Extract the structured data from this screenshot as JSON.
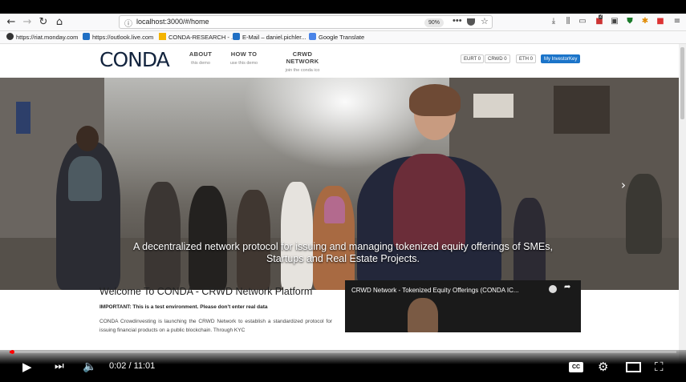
{
  "browser": {
    "url": "localhost:3000/#/home",
    "zoom": "90%",
    "bookmarks": [
      "https://riat.monday.com",
      "https://outlook.live.com",
      "CONDA-RESEARCH - ...",
      "E-Mail – daniel.pichler...",
      "Google Translate"
    ],
    "notif_badge": "2"
  },
  "site": {
    "logo": "CONDA",
    "menu": [
      {
        "title": "ABOUT",
        "sub": "this demo"
      },
      {
        "title": "HOW TO",
        "sub": "use this demo"
      },
      {
        "title": "CRWD NETWORK",
        "sub": "join the conda ico"
      }
    ],
    "balances": [
      "EURT 0",
      "CRWD 0",
      "ETH 0"
    ],
    "investor_key": "My InvestorKey",
    "hero_caption": "A decentralized network protocol for issuing and managing tokenized equity offerings of SMEs, Startups and Real Estate Projects.",
    "welcome_title": "Welcome To CONDA - CRWD Network Platform",
    "important": "IMPORTANT: This is a test environment. Please don't enter real data",
    "paragraph": "CONDA Crowdinvesting is launching the CRWD Network to establish a standardized protocol for issuing financial products on a public blockchain. Through KYC",
    "video_title": "CRWD Network - Tokenized Equity Offerings (CONDA IC..."
  },
  "player": {
    "time": "0:02 / 11:01",
    "progress_fraction": 0.003,
    "cc_label": "CC"
  }
}
